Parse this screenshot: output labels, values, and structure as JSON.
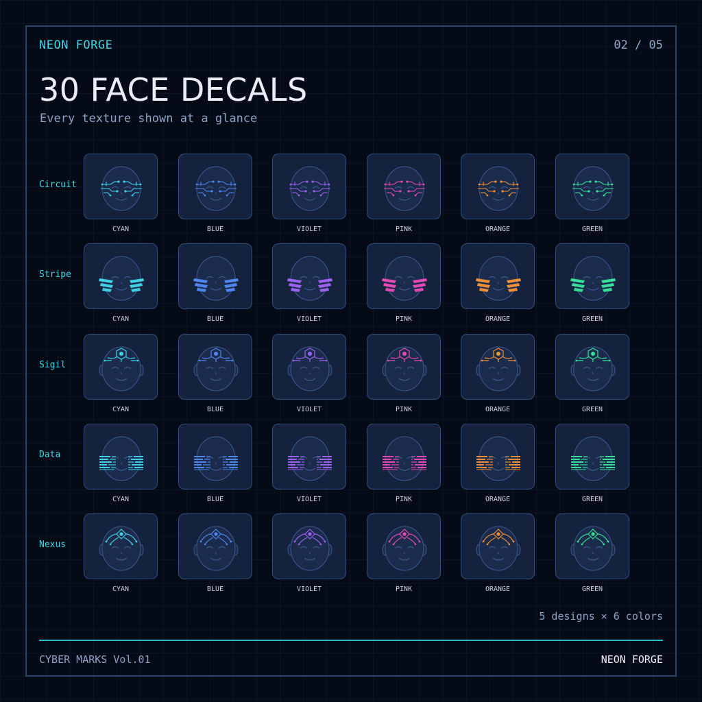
{
  "header": {
    "brand": "NEON FORGE",
    "page_counter": "02 / 05",
    "title": "30 FACE DECALS",
    "subtitle": "Every texture shown at a glance"
  },
  "grid": {
    "rows": [
      {
        "label": "Circuit",
        "design": "circuit"
      },
      {
        "label": "Stripe",
        "design": "stripe"
      },
      {
        "label": "Sigil",
        "design": "sigil"
      },
      {
        "label": "Data",
        "design": "data"
      },
      {
        "label": "Nexus",
        "design": "nexus"
      }
    ],
    "colors": [
      {
        "label": "CYAN",
        "hex": "#3fd0e6"
      },
      {
        "label": "BLUE",
        "hex": "#4f86f0"
      },
      {
        "label": "VIOLET",
        "hex": "#9d62f0"
      },
      {
        "label": "PINK",
        "hex": "#e648b4"
      },
      {
        "label": "ORANGE",
        "hex": "#f08f34"
      },
      {
        "label": "GREEN",
        "hex": "#36e09a"
      }
    ]
  },
  "summary": "5 designs × 6 colors",
  "footer": {
    "series": "CYBER MARKS Vol.01",
    "brand": "NEON FORGE"
  }
}
